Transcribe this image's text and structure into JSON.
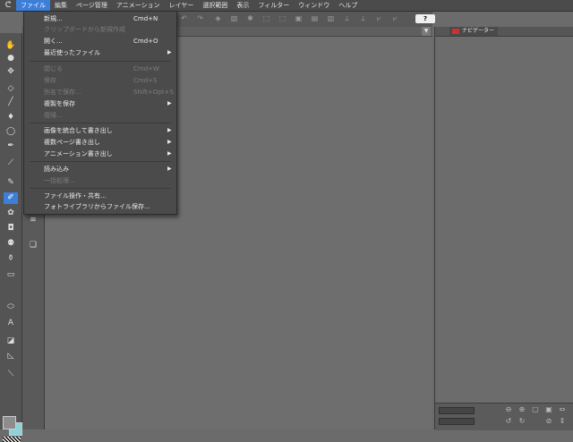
{
  "menubar": {
    "logo": "ᕦ",
    "items": [
      "ファイル",
      "編集",
      "ページ管理",
      "アニメーション",
      "レイヤー",
      "選択範囲",
      "表示",
      "フィルター",
      "ウィンドウ",
      "ヘルプ"
    ]
  },
  "file_menu": {
    "items": [
      {
        "label": "新規...",
        "shortcut": "Cmd+N",
        "enabled": true
      },
      {
        "label": "クリップボードから新規作成",
        "shortcut": "",
        "enabled": false
      },
      {
        "label": "開く...",
        "shortcut": "Cmd+O",
        "enabled": true
      },
      {
        "label": "最近使ったファイル",
        "shortcut": "",
        "enabled": true,
        "submenu": true
      },
      {
        "label": "閉じる",
        "shortcut": "Cmd+W",
        "enabled": false
      },
      {
        "label": "保存",
        "shortcut": "Cmd+S",
        "enabled": false
      },
      {
        "label": "別名で保存...",
        "shortcut": "Shift+Opt+S",
        "enabled": false
      },
      {
        "label": "複製を保存",
        "shortcut": "",
        "enabled": true,
        "submenu": true
      },
      {
        "label": "復帰...",
        "shortcut": "",
        "enabled": false
      },
      {
        "label": "画像を統合して書き出し",
        "shortcut": "",
        "enabled": true,
        "submenu": true
      },
      {
        "label": "複数ページ書き出し",
        "shortcut": "",
        "enabled": true,
        "submenu": true
      },
      {
        "label": "アニメーション書き出し",
        "shortcut": "",
        "enabled": true,
        "submenu": true
      },
      {
        "label": "読み込み",
        "shortcut": "",
        "enabled": true,
        "submenu": true
      },
      {
        "label": "一括処理...",
        "shortcut": "",
        "enabled": false
      },
      {
        "label": "ファイル操作・共有...",
        "shortcut": "",
        "enabled": true
      },
      {
        "label": "フォトライブラリからファイル保存...",
        "shortcut": "",
        "enabled": true
      }
    ]
  },
  "toolbar": {
    "help_label": "?"
  },
  "navigator": {
    "tab_label": "ナビゲーター"
  },
  "tools": [
    {
      "name": "hand-icon",
      "glyph": "✋"
    },
    {
      "name": "zoom-icon",
      "glyph": "●"
    },
    {
      "name": "move-icon",
      "glyph": "✥"
    },
    {
      "name": "select-icon",
      "glyph": "◇"
    },
    {
      "name": "pen-icon",
      "glyph": "╱"
    },
    {
      "name": "brush-icon",
      "glyph": "♦"
    },
    {
      "name": "lasso-icon",
      "glyph": "◯"
    },
    {
      "name": "marker-icon",
      "glyph": "✒"
    },
    {
      "name": "eyedropper-icon",
      "glyph": "⟋"
    },
    {
      "name": "pencil-icon",
      "glyph": "✎"
    },
    {
      "name": "airbrush-icon",
      "glyph": "✐"
    },
    {
      "name": "decoration-icon",
      "glyph": "✿"
    },
    {
      "name": "eraser-icon",
      "glyph": "◘"
    },
    {
      "name": "blend-icon",
      "glyph": "⚉"
    },
    {
      "name": "fill-icon",
      "glyph": "⚱"
    },
    {
      "name": "gradient-icon",
      "glyph": "▭"
    },
    {
      "name": "shape-icon",
      "glyph": "⬭"
    },
    {
      "name": "text-icon",
      "glyph": "A"
    },
    {
      "name": "frame-icon",
      "glyph": "◪"
    },
    {
      "name": "ruler-icon",
      "glyph": "◺"
    },
    {
      "name": "correct-line-icon",
      "glyph": "⟍"
    }
  ],
  "subtools": [
    {
      "name": "sub-layers-icon",
      "glyph": "≋"
    },
    {
      "name": "sub-copy-icon",
      "glyph": "❏"
    }
  ],
  "colors": {
    "main": "#8d8d8d",
    "sub": "#8fd1d8",
    "accent": "#3d7ed8"
  }
}
